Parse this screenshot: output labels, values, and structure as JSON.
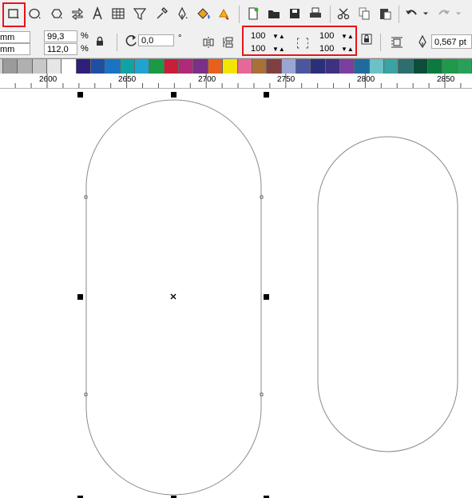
{
  "toolbar": {
    "tools": [
      {
        "name": "rectangle-tool"
      },
      {
        "name": "ellipse-tool"
      },
      {
        "name": "polygon-tool"
      },
      {
        "name": "basic-shapes-tool"
      },
      {
        "name": "text-tool"
      },
      {
        "name": "table-tool"
      },
      {
        "name": "dimension-tool"
      },
      {
        "name": "eyedropper-tool"
      },
      {
        "name": "outline-tool"
      },
      {
        "name": "fill-tool"
      },
      {
        "name": "interactive-fill-tool"
      }
    ],
    "file_actions": [
      "new",
      "open",
      "save",
      "print"
    ],
    "edit_actions": [
      "cut",
      "copy",
      "paste",
      "undo",
      "redo"
    ]
  },
  "property_bar": {
    "unit_1": "mm",
    "unit_2": "mm",
    "scale_x": "99,3",
    "scale_y": "112,0",
    "percent_1": "%",
    "percent_2": "%",
    "rotation": "0,0",
    "degree": "°",
    "corner_tl": "100",
    "corner_bl": "100",
    "corner_tr": "100",
    "corner_br": "100",
    "outline_width": "0,567 pt"
  },
  "palette": {
    "colors": [
      "#9b9b9b",
      "#b0b0b0",
      "#c8c8c8",
      "#e6e6e6",
      "#ffffff",
      "#2e1f7d",
      "#1f4fa3",
      "#1a73c4",
      "#0fa3a3",
      "#1fa3d1",
      "#1c9944",
      "#c81e3a",
      "#b02a7a",
      "#7b2f86",
      "#e8601c",
      "#f2e500",
      "#e7679a",
      "#ab6f3a",
      "#804040",
      "#9aa5d4",
      "#4a56a0",
      "#2b2f7a",
      "#3d3280",
      "#7c3ea0",
      "#1f6b9e",
      "#6cc0c6",
      "#3aa3a3",
      "#2f6e6e",
      "#0d4d3a",
      "#0b7a3e",
      "#1f9a4a",
      "#2a9f5a"
    ]
  },
  "ruler": {
    "labels": [
      "2600",
      "2650",
      "2700",
      "2750",
      "2800",
      "2850"
    ]
  }
}
